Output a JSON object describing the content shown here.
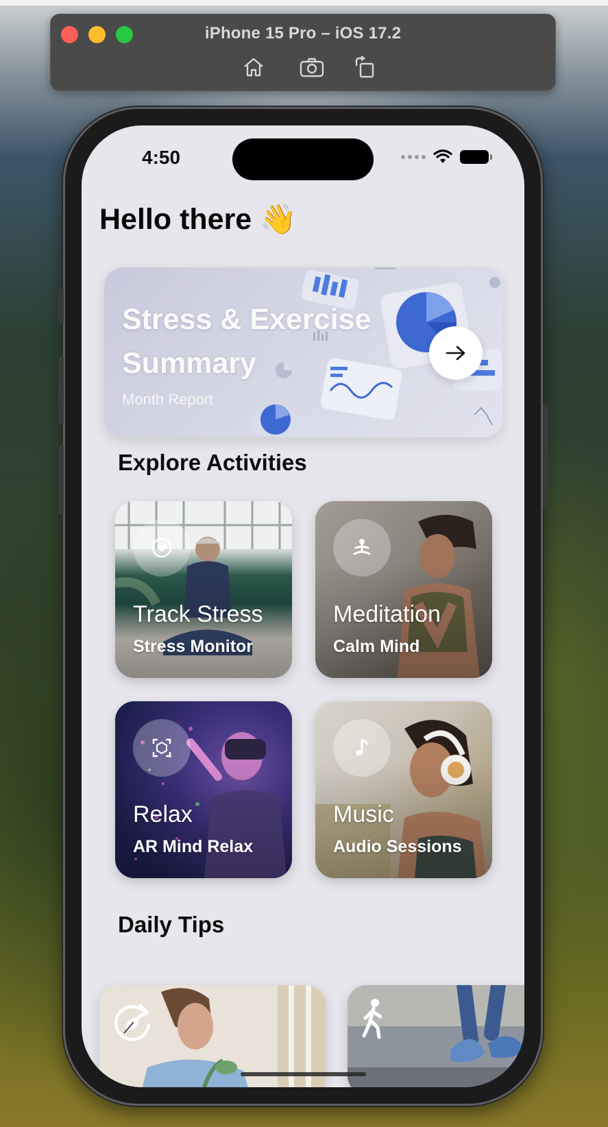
{
  "simulator": {
    "title": "iPhone 15 Pro – iOS 17.2",
    "tools": [
      "home-icon",
      "screenshot-icon",
      "rotate-icon"
    ]
  },
  "status_bar": {
    "time": "4:50"
  },
  "greeting": "Hello there 👋",
  "summary_card": {
    "title": "Stress & Exercise Summary",
    "subtitle": "Month Report"
  },
  "explore": {
    "heading": "Explore Activities",
    "cards": [
      {
        "title": "Track Stress",
        "subtitle": "Stress Monitor",
        "icon": "heart-icon"
      },
      {
        "title": "Meditation",
        "subtitle": "Calm Mind",
        "icon": "meditation-icon"
      },
      {
        "title": "Relax",
        "subtitle": "AR Mind Relax",
        "icon": "ar-icon"
      },
      {
        "title": "Music",
        "subtitle": "Audio Sessions",
        "icon": "music-note-icon"
      }
    ]
  },
  "daily_tips": {
    "heading": "Daily Tips",
    "cards": [
      {
        "icon": "breathing-refresh-icon"
      },
      {
        "icon": "walking-icon"
      }
    ]
  },
  "colors": {
    "screen_bg": "#e6e6ec",
    "accent_blue": "#4a78d8"
  }
}
